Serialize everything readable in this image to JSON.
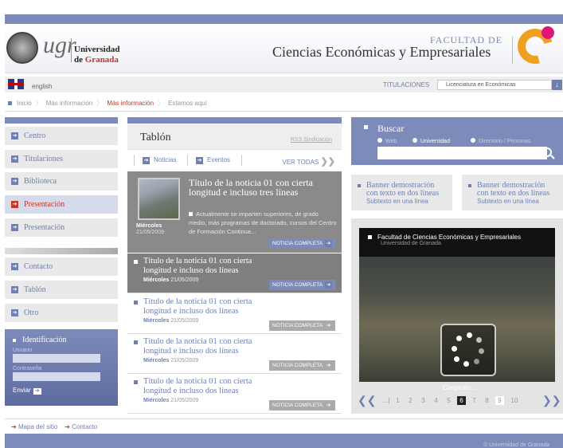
{
  "header": {
    "logo_text": "ugr",
    "university_line1": "Universidad",
    "university_line2_prefix": "de ",
    "university_line2_city": "Granada",
    "faculty_line1": "FACULTAD DE",
    "faculty_line2": "Ciencias Económicas y Empresariales"
  },
  "langbar": {
    "language": "english",
    "titulaciones_label": "TITULACIONES",
    "titulaciones_selected": "Licenciatura en Económicas"
  },
  "breadcrumb": [
    "Inicio",
    "Más información",
    "Más información",
    "Estamos aquí"
  ],
  "sidebar": {
    "items": [
      "Centro",
      "Titulaciones",
      "Biblioteca",
      "Presentación",
      "Presentación"
    ],
    "items2": [
      "Contacto",
      "Tablón",
      "Otro"
    ],
    "login": {
      "title": "Identificación",
      "user_label": "Usuario",
      "pass_label": "Contraseña",
      "submit": "Enviar"
    }
  },
  "tablon": {
    "title": "Tablón",
    "rss": "RSS Sindicación",
    "tab_news": "Noticias",
    "tab_events": "Eventos",
    "view_all": "VER TODAS",
    "featured": {
      "title": "Título de la noticia 01 con cierta longitud e incluso tres líneas",
      "desc": "Actualmente se imparten superiores, de grado medio, más programas de doctorado, cursos del Centro de Formación Continua...",
      "day": "Miércoles",
      "date": "21/05/2009",
      "more": "NOTICIA COMPLETA"
    },
    "news": [
      {
        "title": "Título de la noticia 01 con cierta longitud e incluso dos líneas",
        "day": "Miércoles",
        "date": "21/05/2009",
        "more": "NOTICIA COMPLETA"
      },
      {
        "title": "Título de la noticia 01 con cierta longitud e incluso dos líneas",
        "day": "Miércoles",
        "date": "21/05/2009",
        "more": "NOTICIA COMPLETA"
      },
      {
        "title": "Título de la noticia 01 con cierta longitud e incluso dos líneas",
        "day": "Miércoles",
        "date": "21/05/2009",
        "more": "NOTICIA COMPLETA"
      },
      {
        "title": "Título de la noticia 01 con cierta longitud e incluso dos líneas",
        "day": "Miércoles",
        "date": "21/05/2009",
        "more": "NOTICIA COMPLETA"
      }
    ]
  },
  "search": {
    "title": "Buscar",
    "opt_web": "Web",
    "opt_univ": "Universidad",
    "opt_dir": "Directorio / Personas"
  },
  "banners": [
    {
      "title": "Banner demostración con texto en dos líneas",
      "sub": "Subtexto en una línea"
    },
    {
      "title": "Banner demostración con texto en dos líneas",
      "sub": "Subtexto en una línea"
    }
  ],
  "gallery": {
    "caption": "Facultad de Ciencias Económicas y Empresariales",
    "subcaption": "Universidad de Granada",
    "loading": "Cargando...",
    "pages": [
      "1",
      "2",
      "3",
      "4",
      "5",
      "6",
      "7",
      "8",
      "9",
      "10"
    ],
    "current_page": "6"
  },
  "footer": {
    "link1": "Mapa del sitio",
    "link2": "Contacto",
    "copyright": "© Universidad de Granada"
  },
  "colors": {
    "accent": "#7d8bbb",
    "active": "#c0392b"
  }
}
